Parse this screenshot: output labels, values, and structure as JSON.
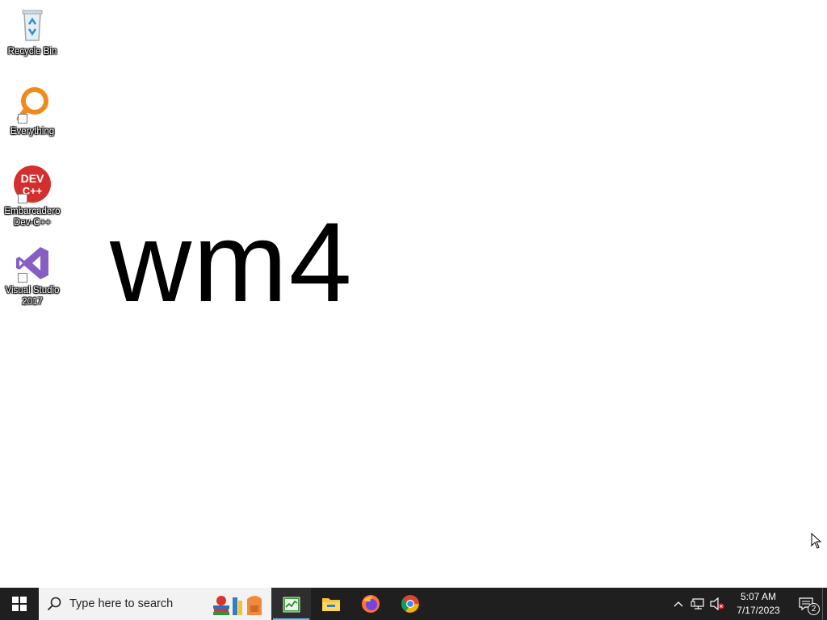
{
  "desktop": {
    "icons": [
      {
        "label": "Recycle Bin",
        "icon": "recycle-bin-icon"
      },
      {
        "label": "Everything",
        "icon": "everything-search-icon"
      },
      {
        "label": "Embarcadero\nDev-C++",
        "icon": "devcpp-icon",
        "badge": "DEV\nC++"
      },
      {
        "label": "Visual Studio\n2017",
        "icon": "visual-studio-icon"
      }
    ],
    "watermark": "wm4"
  },
  "taskbar": {
    "search_placeholder": "Type here to search",
    "apps": [
      {
        "name": "task-manager",
        "icon": "task-manager-icon",
        "active": true
      },
      {
        "name": "file-explorer",
        "icon": "folder-icon",
        "active": false
      },
      {
        "name": "firefox",
        "icon": "firefox-icon",
        "active": false
      },
      {
        "name": "chrome",
        "icon": "chrome-icon",
        "active": false
      }
    ],
    "clock": {
      "time": "5:07 AM",
      "date": "7/17/2023"
    },
    "notification_count": "2"
  },
  "colors": {
    "taskbar_bg": "#1f1f1f",
    "search_bg": "#f2f2f2",
    "accent": "#76b9ed",
    "devcpp_red": "#d32f2f",
    "vs_purple": "#865fc5",
    "everything_orange": "#f08a1c"
  }
}
